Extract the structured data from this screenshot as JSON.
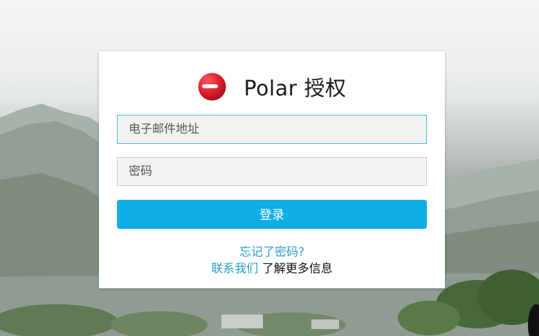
{
  "header": {
    "title": "Polar 授权",
    "logo_icon": "polar-logo-icon",
    "brand_color": "#e0202f"
  },
  "form": {
    "email_placeholder": "电子邮件地址",
    "password_placeholder": "密码",
    "login_label": "登录",
    "accent_color": "#10ade6"
  },
  "links": {
    "forgot_password": "忘记了密码?",
    "contact_us": "联系我们",
    "learn_more": "了解更多信息"
  }
}
